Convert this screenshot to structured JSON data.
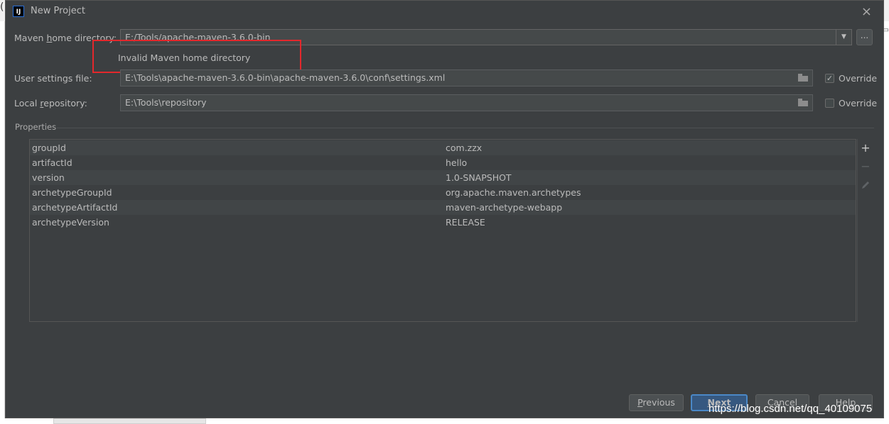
{
  "dialog": {
    "title": "New Project",
    "app_icon_text": "IJ",
    "close_glyph": "×"
  },
  "maven": {
    "home_label_pre": "Maven ",
    "home_label_mnemonic": "h",
    "home_label_post": "ome directory:",
    "home_value": "E:/Tools/apache-maven-3.6.0-bin",
    "dropdown_glyph": "▼",
    "browse_label": "...",
    "error": "Invalid Maven home directory",
    "settings_label": "User settings file:",
    "settings_value": "E:\\Tools\\apache-maven-3.6.0-bin\\apache-maven-3.6.0\\conf\\settings.xml",
    "settings_override_label": "Override",
    "settings_override_checked": true,
    "settings_override_glyph": "✓",
    "repo_label_pre": "Local ",
    "repo_label_mnemonic": "r",
    "repo_label_post": "epository:",
    "repo_value": "E:\\Tools\\repository",
    "repo_override_label": "Override",
    "repo_override_checked": false
  },
  "properties": {
    "title": "Properties",
    "rows": [
      {
        "key": "groupId",
        "value": "com.zzx"
      },
      {
        "key": "artifactId",
        "value": "hello"
      },
      {
        "key": "version",
        "value": "1.0-SNAPSHOT"
      },
      {
        "key": "archetypeGroupId",
        "value": "org.apache.maven.archetypes"
      },
      {
        "key": "archetypeArtifactId",
        "value": "maven-archetype-webapp"
      },
      {
        "key": "archetypeVersion",
        "value": "RELEASE"
      }
    ],
    "add_glyph": "+",
    "remove_glyph": "−"
  },
  "buttons": {
    "previous_mnemonic": "P",
    "previous_rest": "revious",
    "next_mnemonic": "N",
    "next_rest": "ext",
    "cancel": "Cancel",
    "help": "Help"
  },
  "watermark": "https://blog.csdn.net/qq_40109075",
  "colors": {
    "dialog_bg": "#3c3f41",
    "highlight_box": "#e3282c",
    "primary_button": "#365880"
  }
}
